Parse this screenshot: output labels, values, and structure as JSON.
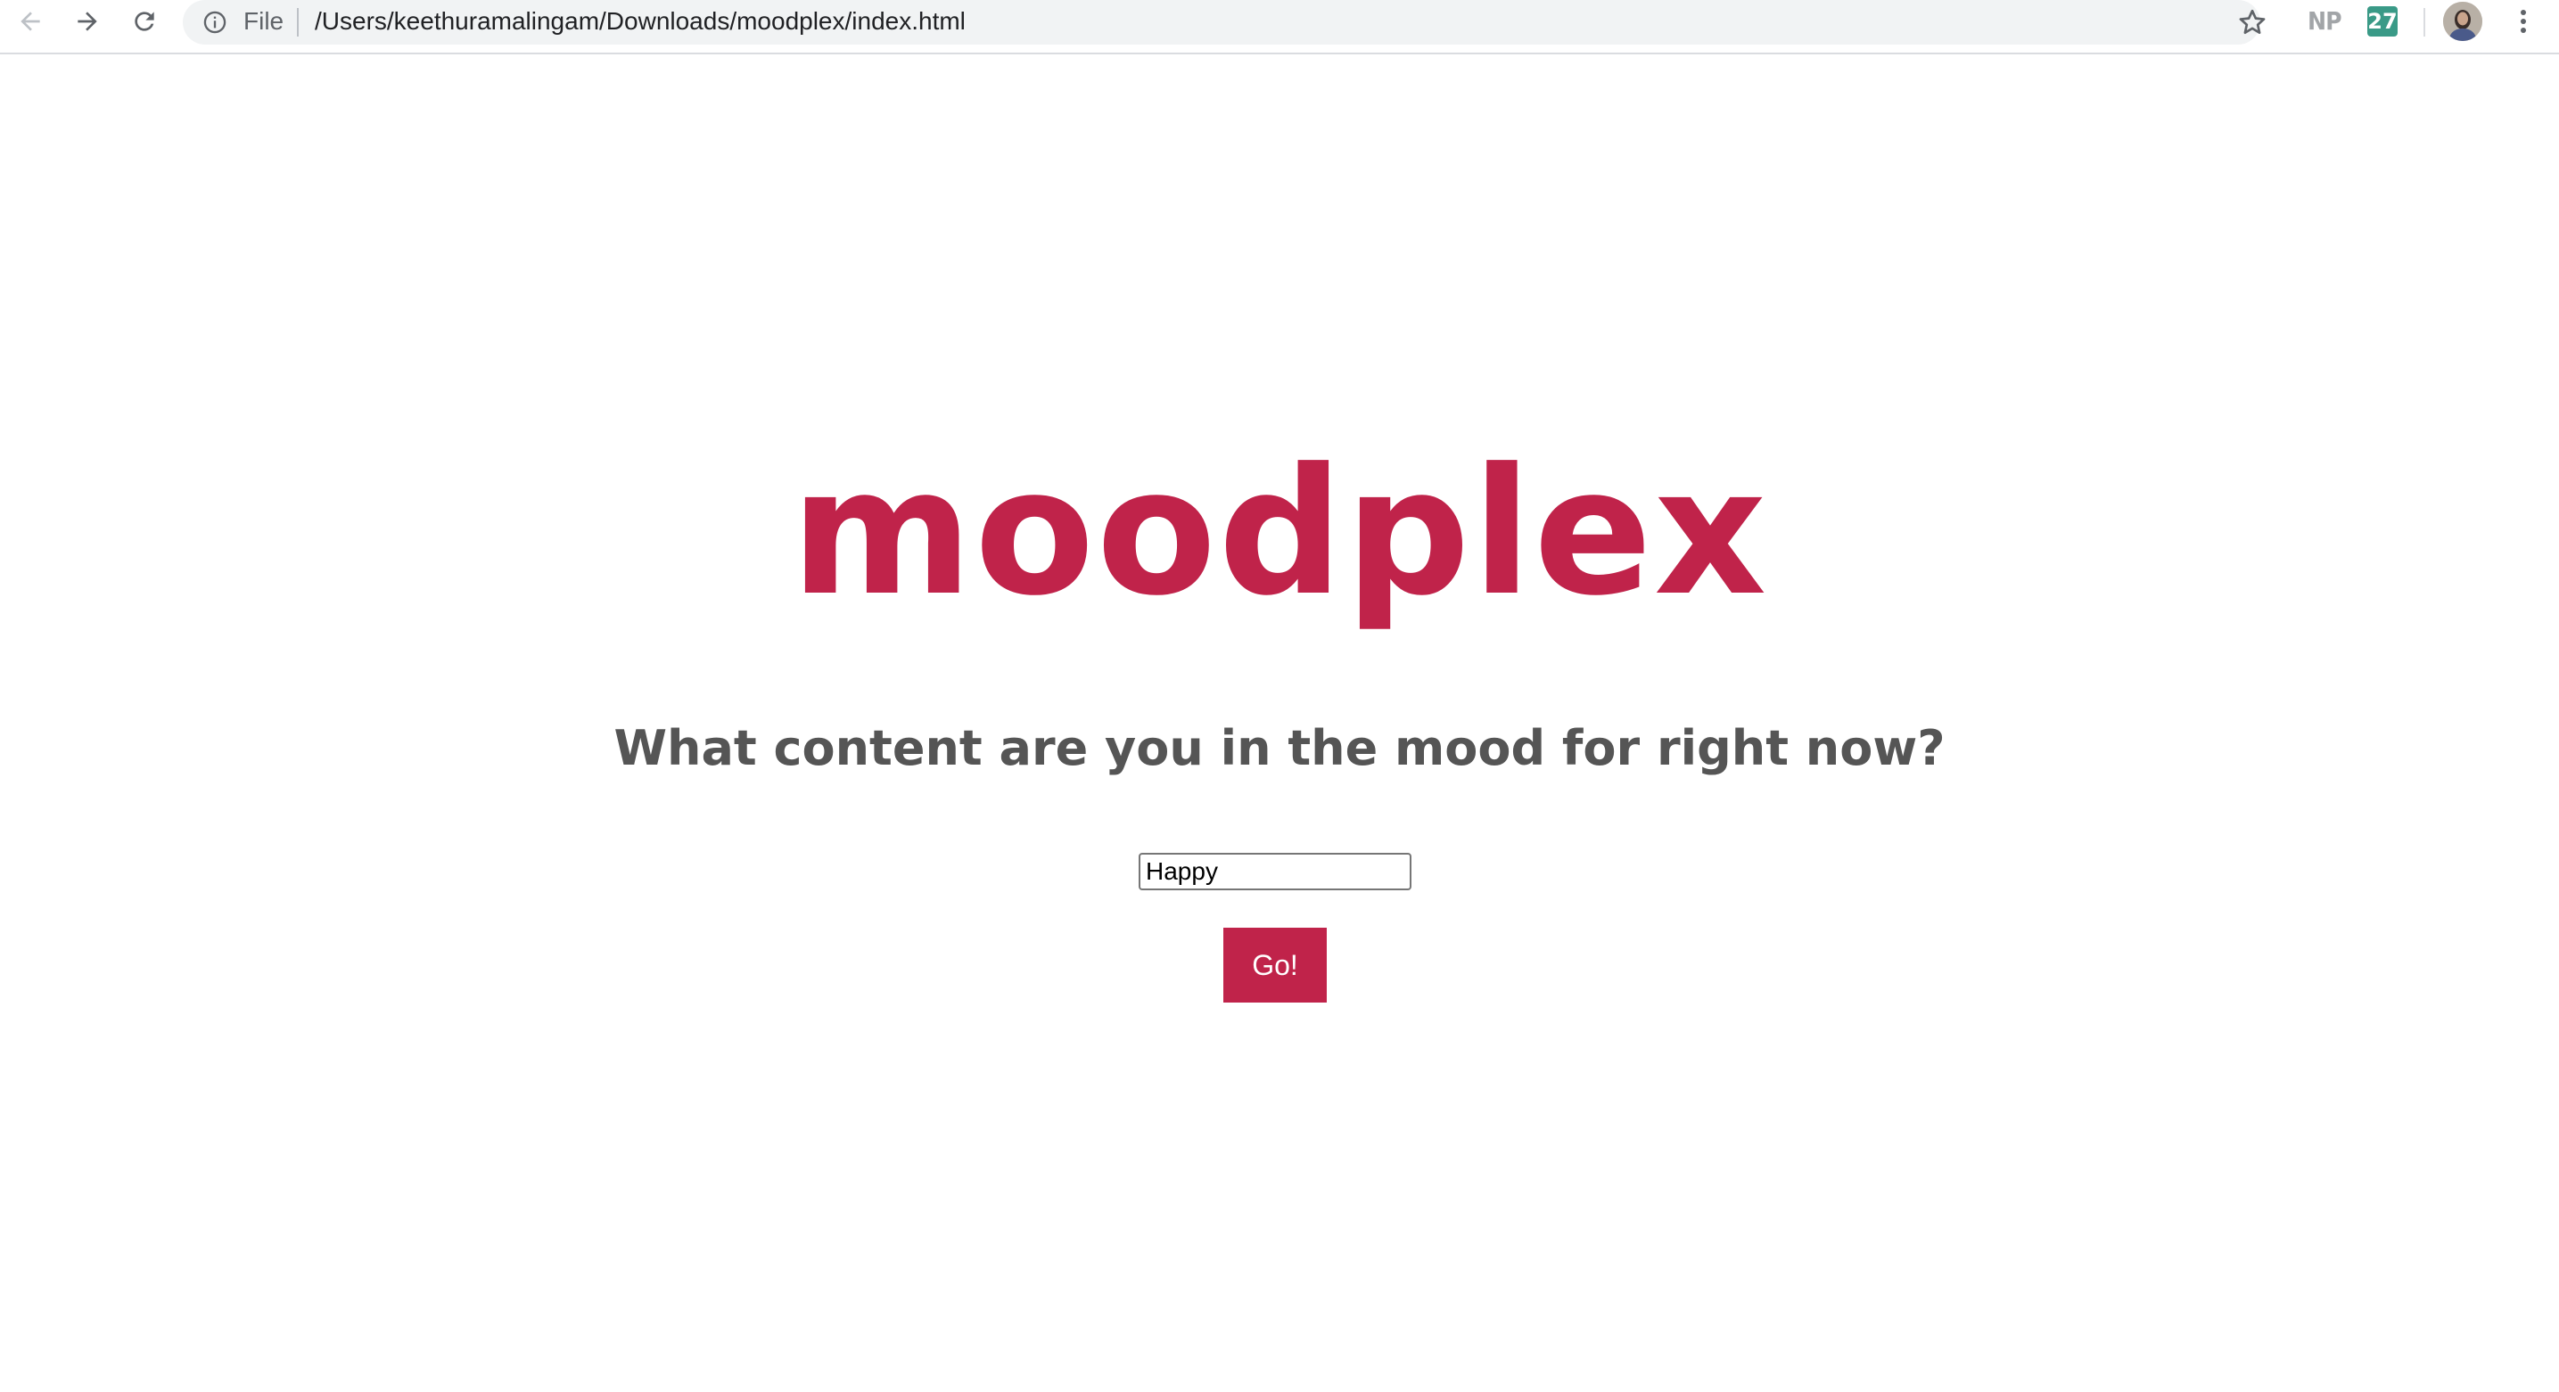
{
  "browser": {
    "scheme_label": "File",
    "url": "/Users/keethuramalingam/Downloads/moodplex/index.html",
    "extensions": {
      "np_label": "NP",
      "calendar_label": "27"
    },
    "colors": {
      "omnibox_bg": "#f1f3f4",
      "calendar_ext": "#3a9a87"
    },
    "icons": [
      "back-arrow-icon",
      "forward-arrow-icon",
      "reload-icon",
      "info-icon",
      "star-icon",
      "avatar",
      "more-vert-icon"
    ]
  },
  "page": {
    "logo": "moodplex",
    "question": "What content are you in the mood for right now?",
    "mood_input_value": "Happy",
    "go_button_label": "Go!",
    "colors": {
      "brand": "#c0234a",
      "question_text": "#555555",
      "background": "#ffffff"
    }
  }
}
